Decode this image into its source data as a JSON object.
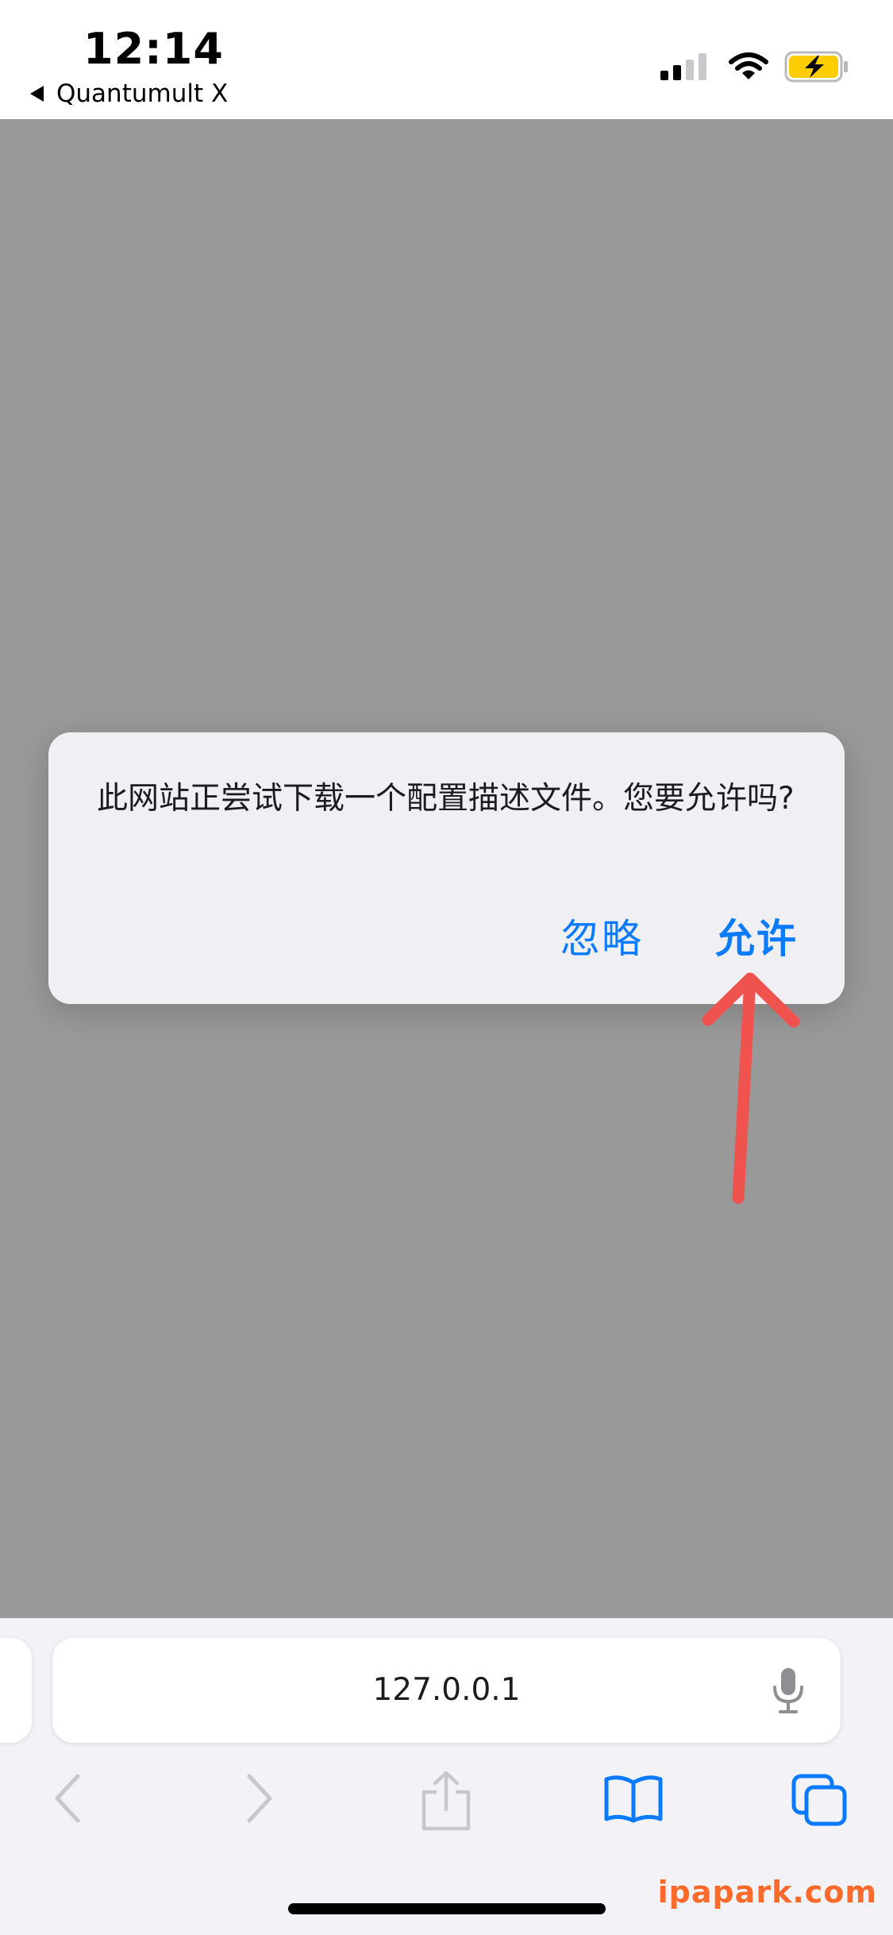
{
  "status_bar": {
    "time": "12:14",
    "back_app": "Quantumult X",
    "battery_color": "#ffcc00"
  },
  "alert": {
    "message": "此网站正尝试下载一个配置描述文件。您要允许吗?",
    "ignore_label": "忽略",
    "allow_label": "允许"
  },
  "toolbar": {
    "url": "127.0.0.1"
  },
  "watermark": "ipapark.com",
  "colors": {
    "accent": "#0a7aff",
    "annotation_arrow": "#f0534e"
  },
  "icons": [
    "signal-icon",
    "wifi-icon",
    "battery-charging-icon",
    "microphone-icon",
    "back-chevron-icon",
    "forward-chevron-icon",
    "share-icon",
    "bookmarks-icon",
    "tabs-icon"
  ]
}
